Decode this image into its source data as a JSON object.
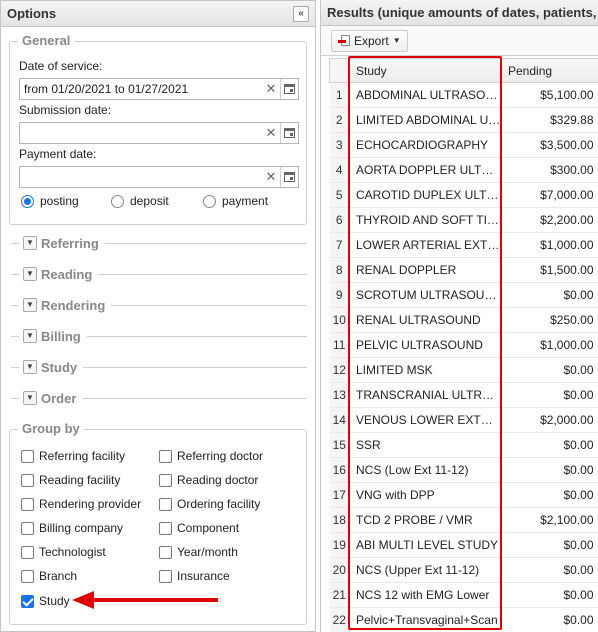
{
  "left": {
    "title": "Options",
    "collapse_symbol": "«",
    "general": {
      "legend": "General",
      "date_of_service": {
        "label": "Date of service:",
        "value": "from 01/20/2021 to 01/27/2021"
      },
      "submission_date": {
        "label": "Submission date:",
        "value": ""
      },
      "payment_date": {
        "label": "Payment date:",
        "value": ""
      },
      "radios": [
        {
          "label": "posting",
          "checked": true
        },
        {
          "label": "deposit",
          "checked": false
        },
        {
          "label": "payment",
          "checked": false
        }
      ]
    },
    "sections": [
      "Referring",
      "Reading",
      "Rendering",
      "Billing",
      "Study",
      "Order"
    ],
    "group_by": {
      "legend": "Group by",
      "checkboxes": [
        {
          "label": "Referring facility",
          "checked": false
        },
        {
          "label": "Referring doctor",
          "checked": false
        },
        {
          "label": "Reading facility",
          "checked": false
        },
        {
          "label": "Reading doctor",
          "checked": false
        },
        {
          "label": "Rendering provider",
          "checked": false
        },
        {
          "label": "Ordering facility",
          "checked": false
        },
        {
          "label": "Billing company",
          "checked": false
        },
        {
          "label": "Component",
          "checked": false
        },
        {
          "label": "Technologist",
          "checked": false
        },
        {
          "label": "Year/month",
          "checked": false
        },
        {
          "label": "Branch",
          "checked": false
        },
        {
          "label": "Insurance",
          "checked": false
        },
        {
          "label": "Study",
          "checked": true
        }
      ]
    }
  },
  "right": {
    "title": "Results (unique amounts of dates, patients, s",
    "export_label": "Export",
    "columns": {
      "study": "Study",
      "pending": "Pending"
    },
    "rows": [
      {
        "n": "1",
        "study": "ABDOMINAL ULTRASOUND",
        "pending": "$5,100.00"
      },
      {
        "n": "2",
        "study": "LIMITED ABDOMINAL ULTRASOUND",
        "pending": "$329.88"
      },
      {
        "n": "3",
        "study": "ECHOCARDIOGRAPHY",
        "pending": "$3,500.00"
      },
      {
        "n": "4",
        "study": "AORTA DOPPLER ULTRASOUND",
        "pending": "$300.00"
      },
      {
        "n": "5",
        "study": "CAROTID DUPLEX ULTRASOUND",
        "pending": "$7,000.00"
      },
      {
        "n": "6",
        "study": "THYROID AND SOFT TISSUE",
        "pending": "$2,200.00"
      },
      {
        "n": "7",
        "study": "LOWER ARTERIAL EXTREMITY",
        "pending": "$1,000.00"
      },
      {
        "n": "8",
        "study": "RENAL DOPPLER",
        "pending": "$1,500.00"
      },
      {
        "n": "9",
        "study": "SCROTUM ULTRASOUND",
        "pending": "$0.00"
      },
      {
        "n": "10",
        "study": "RENAL ULTRASOUND",
        "pending": "$250.00"
      },
      {
        "n": "11",
        "study": "PELVIC ULTRASOUND",
        "pending": "$1,000.00"
      },
      {
        "n": "12",
        "study": "LIMITED MSK",
        "pending": "$0.00"
      },
      {
        "n": "13",
        "study": "TRANSCRANIAL ULTRASOUND",
        "pending": "$0.00"
      },
      {
        "n": "14",
        "study": "VENOUS LOWER EXTREMITY",
        "pending": "$2,000.00"
      },
      {
        "n": "15",
        "study": "SSR",
        "pending": "$0.00"
      },
      {
        "n": "16",
        "study": "NCS (Low Ext 11-12)",
        "pending": "$0.00"
      },
      {
        "n": "17",
        "study": "VNG with DPP",
        "pending": "$0.00"
      },
      {
        "n": "18",
        "study": "TCD 2 PROBE / VMR",
        "pending": "$2,100.00"
      },
      {
        "n": "19",
        "study": "ABI MULTI LEVEL STUDY",
        "pending": "$0.00"
      },
      {
        "n": "20",
        "study": "NCS (Upper Ext 11-12)",
        "pending": "$0.00"
      },
      {
        "n": "21",
        "study": "NCS 12 with EMG Lower",
        "pending": "$0.00"
      },
      {
        "n": "22",
        "study": "Pelvic+Transvaginal+Scan",
        "pending": "$0.00"
      }
    ]
  },
  "colors": {
    "accent": "#1a73e8",
    "annotation": "#dd0000"
  }
}
